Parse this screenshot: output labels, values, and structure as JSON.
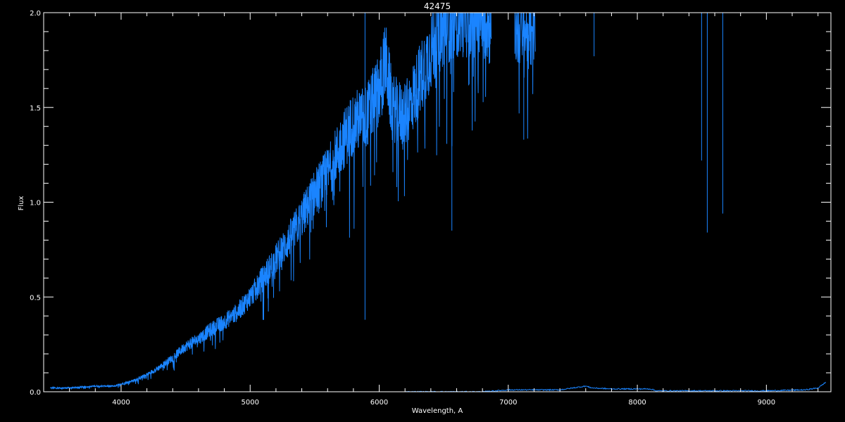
{
  "colors": {
    "background": "#000000",
    "axes": "#ffffff",
    "text": "#ffffff",
    "spectrum": "#1a84ff",
    "error": "#1a84ff"
  },
  "chart_data": {
    "type": "line",
    "title": "42475",
    "xlabel": "Wavelength, A",
    "ylabel": "Flux",
    "xlim": [
      3400,
      9500
    ],
    "ylim": [
      0.0,
      2.0
    ],
    "x_ticks": [
      4000,
      5000,
      6000,
      7000,
      8000,
      9000
    ],
    "x_tick_labels": [
      "4000",
      "5000",
      "6000",
      "7000",
      "8000",
      "9000"
    ],
    "y_ticks": [
      0.0,
      0.5,
      1.0,
      1.5,
      2.0
    ],
    "y_tick_labels": [
      "0.0",
      "0.5",
      "1.0",
      "1.5",
      "2.0"
    ],
    "x_minor_step": 200,
    "y_minor_step": 0.1,
    "grid": false,
    "legend": "none",
    "series": [
      {
        "role": "flux",
        "x": [
          3450,
          3600,
          3800,
          3950,
          4100,
          4200,
          4300,
          4400,
          4500,
          4600,
          4700,
          4800,
          4900,
          5000,
          5100,
          5200,
          5300,
          5400,
          5500,
          5600,
          5700,
          5800,
          5900,
          6000,
          6050,
          6100,
          6200,
          6300,
          6400,
          6500,
          6600,
          6700,
          6800,
          6850,
          7050,
          7100,
          7150,
          7200,
          7650,
          7700,
          8500,
          8550,
          8650,
          8700
        ],
        "y": [
          0.02,
          0.02,
          0.03,
          0.03,
          0.06,
          0.09,
          0.13,
          0.18,
          0.24,
          0.28,
          0.33,
          0.37,
          0.42,
          0.5,
          0.6,
          0.7,
          0.8,
          0.92,
          1.05,
          1.15,
          1.3,
          1.42,
          1.45,
          1.6,
          1.75,
          1.5,
          1.45,
          1.62,
          1.8,
          1.95,
          2.0,
          2.0,
          2.0,
          1.95,
          2.0,
          1.9,
          1.95,
          1.98,
          2.0,
          2.0,
          2.0,
          2.0,
          2.0,
          2.0
        ]
      },
      {
        "role": "error",
        "x": [
          6200,
          6800,
          7000,
          7400,
          7600,
          7650,
          7800,
          8100,
          8150,
          8500,
          9000,
          9300,
          9400,
          9460
        ],
        "y": [
          0.0,
          0.0,
          0.01,
          0.01,
          0.03,
          0.02,
          0.015,
          0.015,
          0.005,
          0.005,
          0.005,
          0.01,
          0.02,
          0.05
        ]
      }
    ],
    "absorption_lines": [
      {
        "x": 5890,
        "y": 0.38
      },
      {
        "x": 6563,
        "y": 0.85
      },
      {
        "x": 7120,
        "y": 1.33
      },
      {
        "x": 7665,
        "y": 1.77
      },
      {
        "x": 8498,
        "y": 1.22
      },
      {
        "x": 8542,
        "y": 0.84
      },
      {
        "x": 8662,
        "y": 0.94
      }
    ]
  }
}
